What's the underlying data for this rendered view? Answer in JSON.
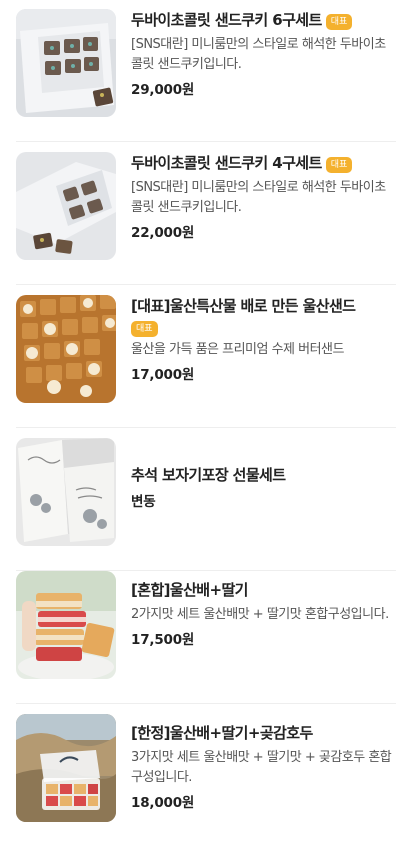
{
  "products": [
    {
      "title": "두바이초콜릿 샌드쿠키 6구세트",
      "badge": "대표",
      "description": "[SNS대란] 미니룸만의 스타일로 해석한 두바이초콜릿 샌드쿠키입니다.",
      "price": "29,000원",
      "image": "cookie-6-box-photo"
    },
    {
      "title": "두바이초콜릿 샌드쿠키 4구세트",
      "badge": "대표",
      "description": "[SNS대란] 미니룸만의 스타일로 해석한 두바이초콜릿 샌드쿠키입니다.",
      "price": "22,000원",
      "image": "cookie-4-box-photo"
    },
    {
      "title": "[대표]울산특산물 배로 만든 울산샌드",
      "badge": "대표",
      "description": "울산을 가득 품은 프리미엄 수제 버터샌드",
      "price": "17,000원",
      "image": "ulsan-sand-tray-photo"
    },
    {
      "title": "추석 보자기포장 선물세트",
      "badge": "",
      "description": "",
      "price": "변동",
      "image": "chuseok-gift-box-photo"
    },
    {
      "title": "[혼합]울산배+딸기",
      "badge": "",
      "description": "2가지맛 세트 울산배맛 + 딸기맛 혼합구성입니다.",
      "price": "17,500원",
      "image": "pear-strawberry-stack-photo"
    },
    {
      "title": "[한정]울산배+딸기+곶감호두",
      "badge": "",
      "description": "3가지맛 세트 울산배맛 + 딸기맛 + 곶감호두 혼합구성입니다.",
      "price": "18,000원",
      "image": "three-flavor-box-photo"
    }
  ],
  "colors": {
    "badge": "#f4b12e",
    "divider": "#eeeeee",
    "title": "#222222",
    "description": "#555555"
  }
}
